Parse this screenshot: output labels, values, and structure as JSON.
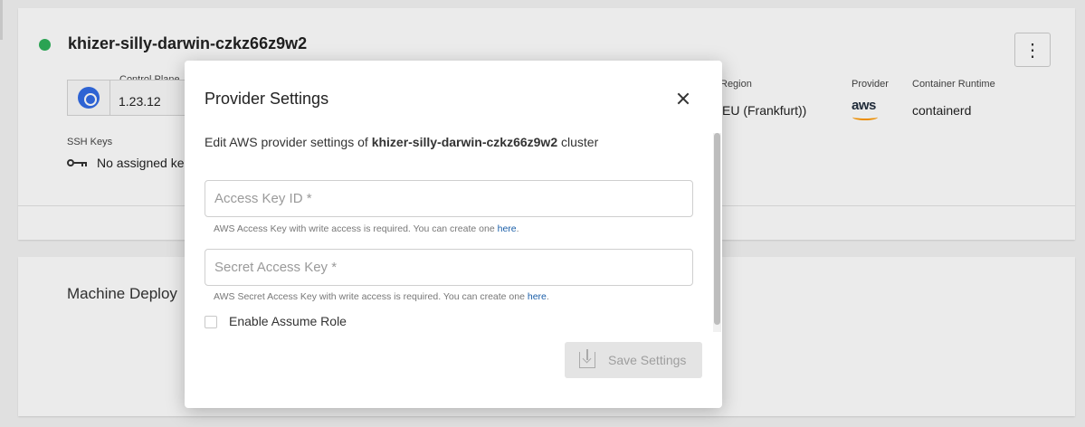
{
  "cluster": {
    "name": "khizer-silly-darwin-czkz66z9w2",
    "status_color": "#2fb15b",
    "control_plane_label": "Control Plane",
    "control_plane_version": "1.23.12",
    "region_label": "Region",
    "region_value": "DE (EU (Frankfurt))",
    "provider_label": "Provider",
    "provider_logo_text": "aws",
    "runtime_label": "Container Runtime",
    "runtime_value": "containerd",
    "ssh_keys_label": "SSH Keys",
    "ssh_keys_value": "No assigned ke"
  },
  "machine_deployments_title": "Machine Deploy",
  "modal": {
    "title": "Provider Settings",
    "description_prefix": "Edit AWS provider settings of",
    "description_cluster": "khizer-silly-darwin-czkz66z9w2",
    "description_suffix": "cluster",
    "access_key": {
      "placeholder": "Access Key ID *",
      "value": "",
      "hint_text": "AWS Access Key with write access is required. You can create one",
      "hint_link": "here"
    },
    "secret_key": {
      "placeholder": "Secret Access Key *",
      "value": "",
      "hint_text": "AWS Secret Access Key with write access is required. You can create one",
      "hint_link": "here"
    },
    "assume_role_label": "Enable Assume Role",
    "assume_role_checked": false,
    "save_button_label": "Save Settings"
  },
  "colors": {
    "accent_link": "#1a5ea8",
    "aws_orange": "#ff9900",
    "kubernetes_blue": "#326ce5"
  }
}
